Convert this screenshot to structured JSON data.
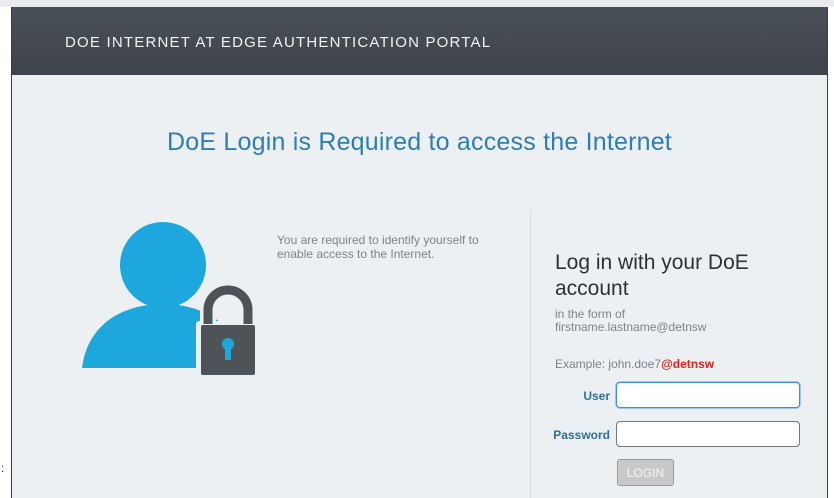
{
  "header": {
    "title": "DOE INTERNET AT EDGE AUTHENTICATION PORTAL"
  },
  "main": {
    "heading": "DoE Login is Required to access the Internet",
    "info_text": "You are required to identify yourself to enable access to the Internet."
  },
  "login": {
    "heading": "Log in with your DoE account",
    "hint_line1": "in the form of",
    "hint_line2": "firstname.lastname@detnsw",
    "example_prefix": "Example: john.doe7",
    "example_domain": "@detnsw",
    "user_label": "User",
    "user_value": "",
    "password_label": "Password",
    "password_value": "",
    "button_label": "LOGIN"
  },
  "edge_glyph": ":",
  "icons": [
    "user-icon",
    "lock-icon"
  ],
  "colors": {
    "header_bg": "#454a50",
    "page_bg": "#ecf0f3",
    "heading_blue": "#2e7db6",
    "icon_blue": "#1ea7dc",
    "lock_gray": "#4e5357",
    "domain_red": "#e0221b"
  }
}
